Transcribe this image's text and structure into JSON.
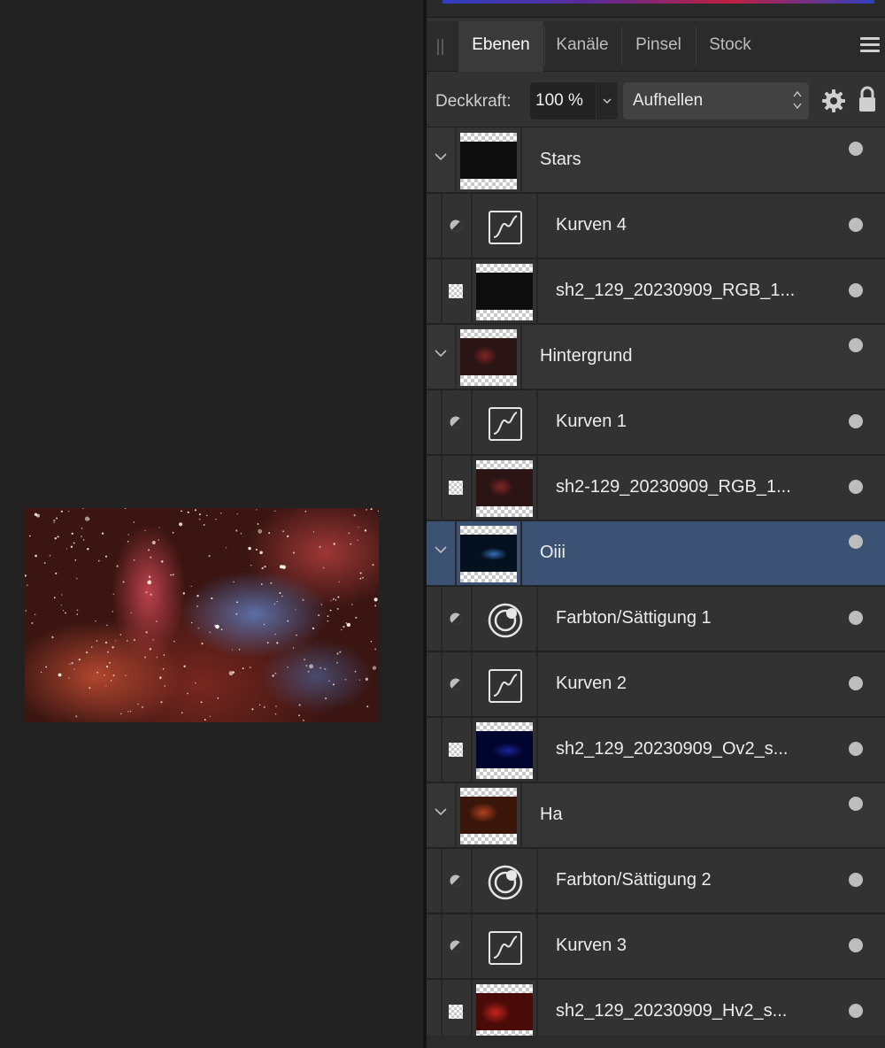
{
  "tabs": [
    {
      "label": "Ebenen",
      "active": true
    },
    {
      "label": "Kanäle",
      "active": false
    },
    {
      "label": "Pinsel",
      "active": false
    },
    {
      "label": "Stock",
      "active": false
    }
  ],
  "options": {
    "opacity_label": "Deckkraft:",
    "opacity_value": "100 %",
    "blend_mode": "Aufhellen"
  },
  "layers": [
    {
      "type": "group",
      "name": "Stars",
      "expanded": true,
      "selected": false,
      "thumb": "stars"
    },
    {
      "type": "adjustment",
      "kind": "curves",
      "name": "Kurven 4"
    },
    {
      "type": "pixel",
      "name": "sh2_129_20230909_RGB_1...",
      "thumb": "stars"
    },
    {
      "type": "group",
      "name": "Hintergrund",
      "expanded": true,
      "selected": false,
      "thumb": "background"
    },
    {
      "type": "adjustment",
      "kind": "curves",
      "name": "Kurven 1"
    },
    {
      "type": "pixel",
      "name": "sh2-129_20230909_RGB_1...",
      "thumb": "background"
    },
    {
      "type": "group",
      "name": "Oiii",
      "expanded": true,
      "selected": true,
      "thumb": "oiii"
    },
    {
      "type": "adjustment",
      "kind": "hsl",
      "name": "Farbton/Sättigung 1"
    },
    {
      "type": "adjustment",
      "kind": "curves",
      "name": "Kurven 2"
    },
    {
      "type": "pixel",
      "name": "sh2_129_20230909_Ov2_s...",
      "thumb": "oiii_raw"
    },
    {
      "type": "group",
      "name": "Ha",
      "expanded": true,
      "selected": false,
      "thumb": "ha"
    },
    {
      "type": "adjustment",
      "kind": "hsl",
      "name": "Farbton/Sättigung 2"
    },
    {
      "type": "adjustment",
      "kind": "curves",
      "name": "Kurven 3"
    },
    {
      "type": "pixel",
      "name": "sh2_129_20230909_Hv2_s...",
      "thumb": "ha_raw"
    }
  ],
  "icons": {
    "panel_menu": "hamburger-icon",
    "settings": "gear-icon",
    "lock": "lock-icon",
    "expand": "chevron-down-icon",
    "visibility": "visibility-dot-icon",
    "adjustment_type": "half-circle-icon",
    "pixel_type": "checker-icon",
    "curves": "curves-icon",
    "hsl": "hue-saturation-icon"
  },
  "colors": {
    "panel_bg": "#323232",
    "selected_row": "#3b5275",
    "canvas_bg": "#222222"
  }
}
